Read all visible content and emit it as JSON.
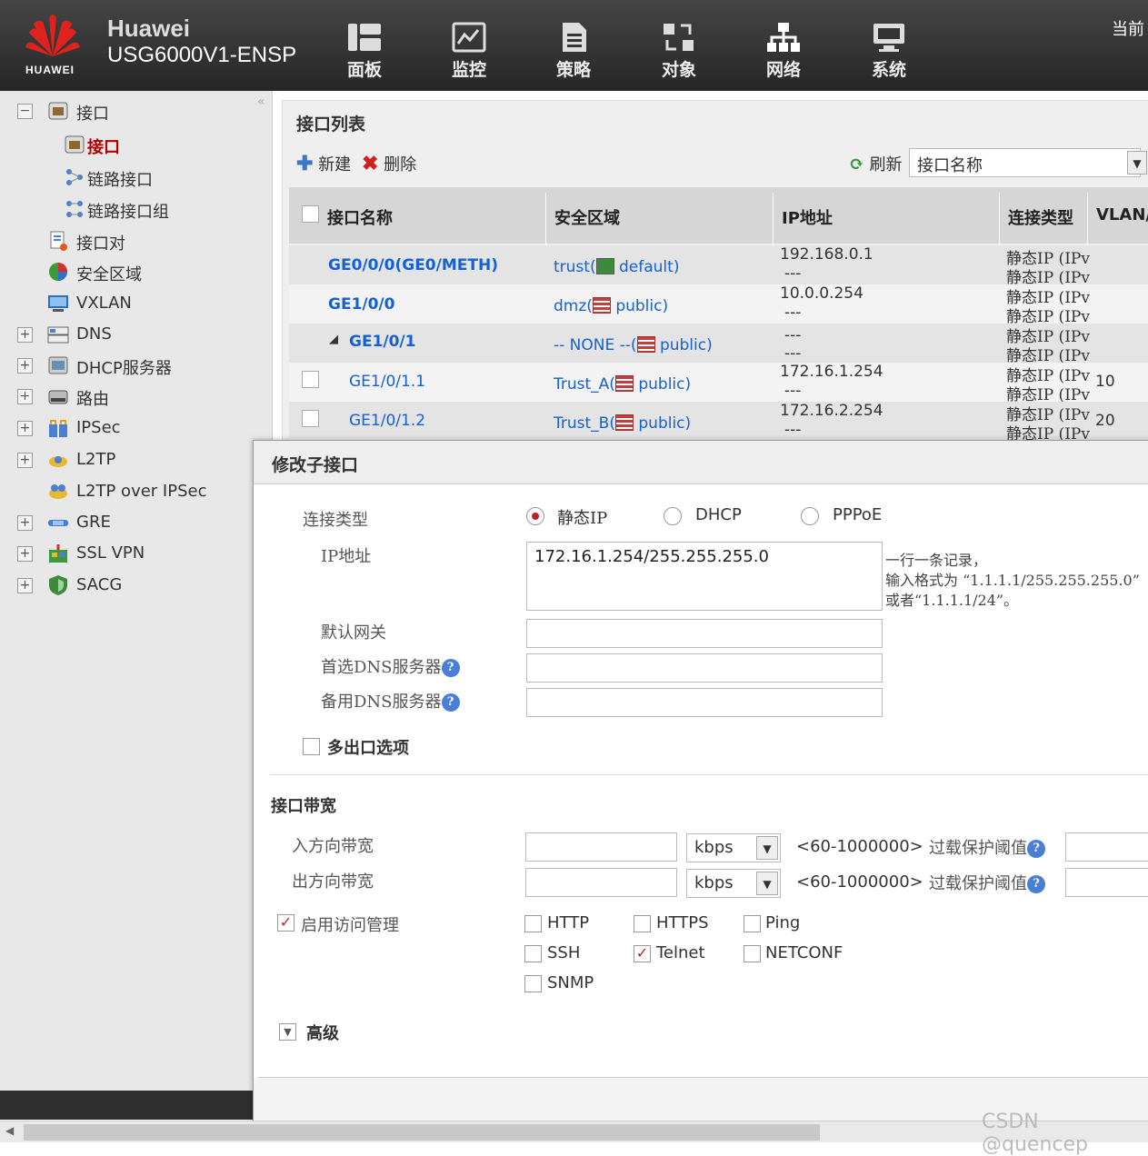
{
  "header": {
    "brand": "Huawei",
    "model": "USG6000V1-ENSP",
    "logo_text": "HUAWEI",
    "current": "当前",
    "nav": [
      {
        "label": "面板",
        "icon": "dashboard-icon"
      },
      {
        "label": "监控",
        "icon": "monitor-icon"
      },
      {
        "label": "策略",
        "icon": "policy-icon"
      },
      {
        "label": "对象",
        "icon": "object-icon"
      },
      {
        "label": "网络",
        "icon": "network-icon"
      },
      {
        "label": "系统",
        "icon": "system-icon"
      }
    ]
  },
  "sidebar": {
    "collapse": "«",
    "items": [
      {
        "label": "接口",
        "expander": "−"
      },
      {
        "label": "接口"
      },
      {
        "label": "链路接口"
      },
      {
        "label": "链路接口组"
      },
      {
        "label": "接口对"
      },
      {
        "label": "安全区域"
      },
      {
        "label": "VXLAN"
      },
      {
        "label": "DNS",
        "expander": "+"
      },
      {
        "label": "DHCP服务器",
        "expander": "+"
      },
      {
        "label": "路由",
        "expander": "+"
      },
      {
        "label": "IPSec",
        "expander": "+"
      },
      {
        "label": "L2TP",
        "expander": "+"
      },
      {
        "label": "L2TP over IPSec"
      },
      {
        "label": "GRE",
        "expander": "+"
      },
      {
        "label": "SSL VPN",
        "expander": "+"
      },
      {
        "label": "SACG",
        "expander": "+"
      }
    ]
  },
  "list": {
    "title": "接口列表",
    "new": "新建",
    "delete": "删除",
    "refresh": "刷新",
    "search_value": "接口名称",
    "columns": [
      "接口名称",
      "安全区域",
      "IP地址",
      "连接类型",
      "VLAN/"
    ],
    "rows": [
      {
        "name": "GE0/0/0(GE0/METH)",
        "zone_pre": "trust(",
        "zone_post": " default)",
        "ip1": "192.168.0.1",
        "ip2": "---",
        "type1": "静态IP (IPv",
        "type2": "静态IP (IPv",
        "vlan": ""
      },
      {
        "name": "GE1/0/0",
        "zone_pre": "dmz(",
        "zone_post": " public)",
        "ip1": "10.0.0.254",
        "ip2": "---",
        "type1": "静态IP (IPv",
        "type2": "静态IP (IPv",
        "vlan": ""
      },
      {
        "name": "GE1/0/1",
        "expander": "◢",
        "zone_pre": "-- NONE --(",
        "zone_post": " public)",
        "ip1": "---",
        "ip2": "---",
        "type1": "静态IP (IPv",
        "type2": "静态IP (IPv",
        "vlan": ""
      },
      {
        "name": "GE1/0/1.1",
        "zone_pre": "Trust_A(",
        "zone_post": " public)",
        "ip1": "172.16.1.254",
        "ip2": "---",
        "type1": "静态IP (IPv",
        "type2": "静态IP (IPv",
        "vlan": "10"
      },
      {
        "name": "GE1/0/1.2",
        "zone_pre": "Trust_B(",
        "zone_post": " public)",
        "ip1": "172.16.2.254",
        "ip2": "---",
        "type1": "静态IP (IPv",
        "type2": "静态IP (IPv",
        "vlan": "20"
      }
    ]
  },
  "dialog": {
    "title": "修改子接口",
    "conn_label": "连接类型",
    "radio_static": "静态IP",
    "radio_dhcp": "DHCP",
    "radio_pppoe": "PPPoE",
    "ip_label": "IP地址",
    "ip_value": "172.16.1.254/255.255.255.0",
    "ip_hint1": "一行一条记录，",
    "ip_hint2": "输入格式为 “1.1.1.1/255.255.255.0”",
    "ip_hint3": "或者“1.1.1.1/24”。",
    "gw_label": "默认网关",
    "dns1_label": "首选DNS服务器",
    "dns2_label": "备用DNS服务器",
    "help": "?",
    "multi_exit": "多出口选项",
    "bw_title": "接口带宽",
    "in_bw": "入方向带宽",
    "out_bw": "出方向带宽",
    "unit": "kbps",
    "range": "<60-1000000>",
    "overload": "过载保护阈值",
    "access_mgmt": "启用访问管理",
    "check_mark": "✓",
    "protocols": [
      {
        "label": "HTTP",
        "checked": false
      },
      {
        "label": "HTTPS",
        "checked": false
      },
      {
        "label": "Ping",
        "checked": false
      },
      {
        "label": "SSH",
        "checked": false
      },
      {
        "label": "Telnet",
        "checked": true
      },
      {
        "label": "NETCONF",
        "checked": false
      },
      {
        "label": "SNMP",
        "checked": false
      }
    ],
    "advanced": "高级",
    "advanced_arrow": "▼"
  },
  "watermark": "CSDN @quencep"
}
